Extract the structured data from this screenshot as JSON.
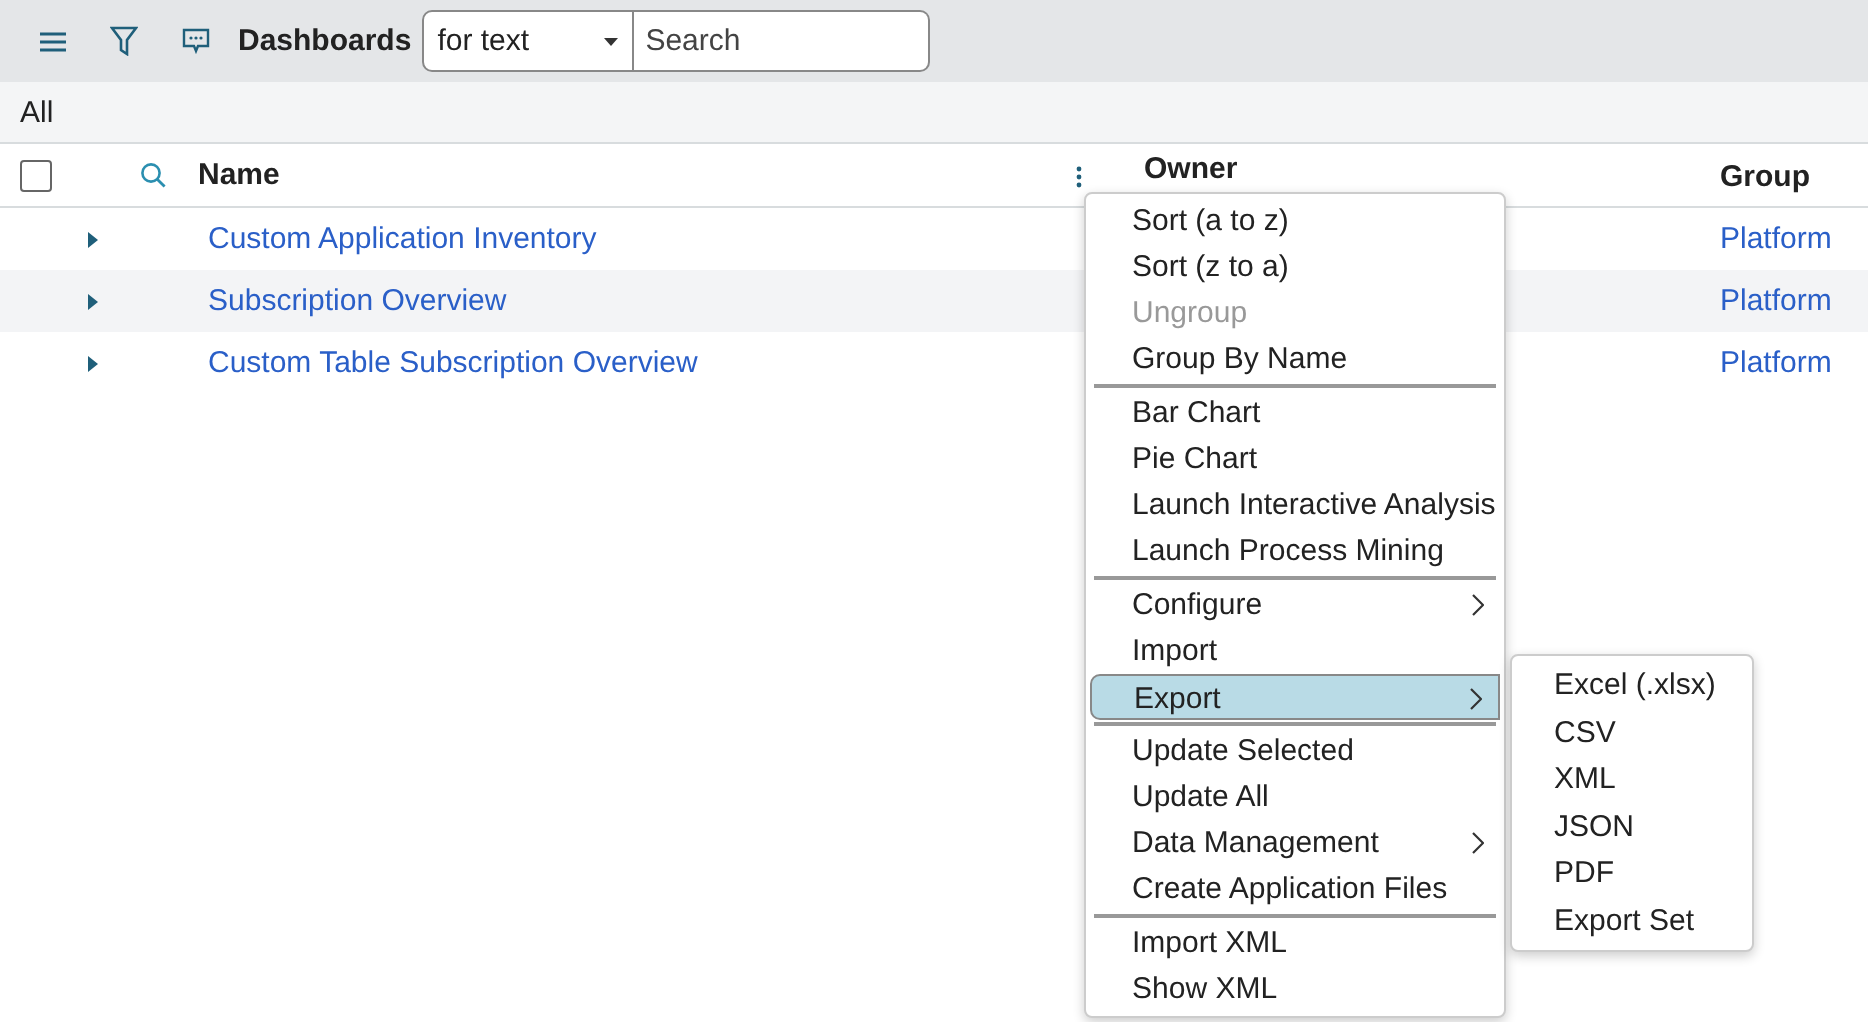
{
  "toolbar": {
    "title": "Dashboards",
    "filter_select": {
      "value": "for text"
    },
    "search": {
      "placeholder": "Search"
    }
  },
  "breadcrumb": "All",
  "table": {
    "select_all": {
      "checked": false
    },
    "columns": [
      {
        "label": "Name"
      },
      {
        "label": "Owner"
      },
      {
        "label": "Group"
      }
    ],
    "rows": [
      {
        "name": "Custom Application Inventory",
        "group": "Platform",
        "selected": false
      },
      {
        "name": "Subscription Overview",
        "group": "Platform",
        "selected": true
      },
      {
        "name": "Custom Table Subscription Overview",
        "group": "Platform",
        "selected": false
      }
    ]
  },
  "context_menu": {
    "sections": [
      [
        {
          "label": "Sort (a to z)",
          "disabled": false,
          "submenu": false,
          "selected": false
        },
        {
          "label": "Sort (z to a)",
          "disabled": false,
          "submenu": false,
          "selected": false
        },
        {
          "label": "Ungroup",
          "disabled": true,
          "submenu": false,
          "selected": false
        },
        {
          "label": "Group By Name",
          "disabled": false,
          "submenu": false,
          "selected": false
        }
      ],
      [
        {
          "label": "Bar Chart",
          "disabled": false,
          "submenu": false,
          "selected": false
        },
        {
          "label": "Pie Chart",
          "disabled": false,
          "submenu": false,
          "selected": false
        },
        {
          "label": "Launch Interactive Analysis",
          "disabled": false,
          "submenu": false,
          "selected": false
        },
        {
          "label": "Launch Process Mining",
          "disabled": false,
          "submenu": false,
          "selected": false
        }
      ],
      [
        {
          "label": "Configure",
          "disabled": false,
          "submenu": true,
          "selected": false
        },
        {
          "label": "Import",
          "disabled": false,
          "submenu": false,
          "selected": false
        },
        {
          "label": "Export",
          "disabled": false,
          "submenu": true,
          "selected": true
        }
      ],
      [
        {
          "label": "Update Selected",
          "disabled": false,
          "submenu": false,
          "selected": false
        },
        {
          "label": "Update All",
          "disabled": false,
          "submenu": false,
          "selected": false
        },
        {
          "label": "Data Management",
          "disabled": false,
          "submenu": true,
          "selected": false
        },
        {
          "label": "Create Application Files",
          "disabled": false,
          "submenu": false,
          "selected": false
        }
      ],
      [
        {
          "label": "Import XML",
          "disabled": false,
          "submenu": false,
          "selected": false
        },
        {
          "label": "Show XML",
          "disabled": false,
          "submenu": false,
          "selected": false
        }
      ]
    ],
    "submenu": [
      "Excel (.xlsx)",
      "CSV",
      "XML",
      "JSON",
      "PDF",
      "Export Set"
    ]
  }
}
